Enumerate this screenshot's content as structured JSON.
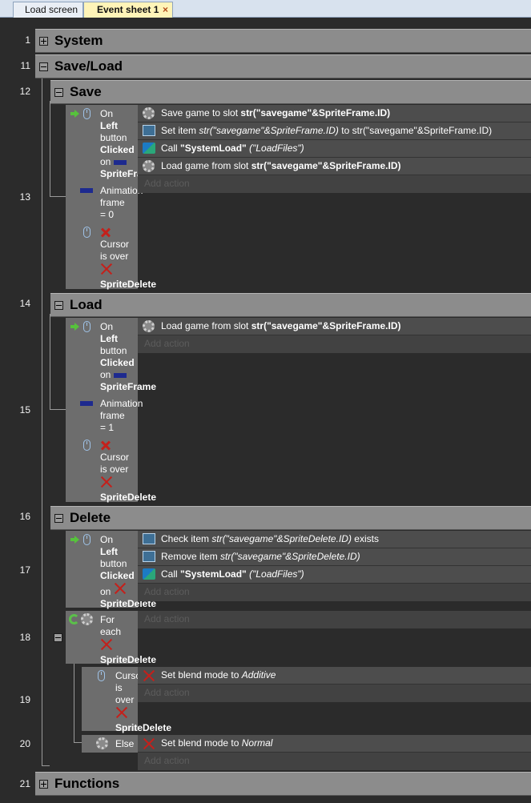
{
  "tabs": [
    "Load screen",
    "Event sheet 1"
  ],
  "tab_close": "×",
  "line_numbers": [
    "1",
    "11",
    "12",
    "13",
    "14",
    "15",
    "16",
    "17",
    "18",
    "19",
    "20",
    "21"
  ],
  "groups": {
    "system": "System",
    "saveload": "Save/Load",
    "save": "Save",
    "load": "Load",
    "delete": "Delete",
    "functions": "Functions"
  },
  "cond": {
    "on": "On",
    "left": "Left",
    "button": "button",
    "clicked": "Clicked",
    "on2": "on",
    "spriteframe": "SpriteFrame",
    "spriteframe_cut": "SpriteFrame",
    "animation": "Animation",
    "frame": "frame",
    "eq0": "= 0",
    "eq1": "= 1",
    "cursor": "Cursor",
    "isover": "is over",
    "is": "is",
    "over": "over",
    "spritedelete": "SpriteDelete",
    "spritedelete_cut": "SpriteDelete",
    "cursor_cut": "Cursc",
    "foreach": "For",
    "each": "each",
    "else": "Else"
  },
  "actions": {
    "save_slot_pre": "Save game to slot ",
    "save_slot_arg": "str(\"savegame\"&SpriteFrame.ID)",
    "setitem_pre": "Set item ",
    "setitem_key": "str(\"savegame\"&SpriteFrame.ID)",
    "setitem_mid": " to ",
    "setitem_val": "str(\"savegame\"&SpriteFrame.ID)",
    "call_pre": "Call ",
    "call_name": "\"SystemLoad\"",
    "call_args": "(\"LoadFiles\")",
    "loadgame_pre": "Load game from slot ",
    "loadgame_arg": "str(\"savegame\"&SpriteFrame.ID)",
    "check_pre": "Check item ",
    "check_arg": "str(\"savegame\"&SpriteDelete.ID)",
    "check_post": " exists",
    "remove_pre": "Remove item ",
    "remove_arg": "str(\"savegame\"&SpriteDelete.ID)",
    "blend_pre": "Set blend mode to ",
    "blend_additive": "Additive",
    "blend_normal": "Normal",
    "add_action": "Add action"
  },
  "colors": {
    "group": "#8c8c8c",
    "condition": "#6d6d6d",
    "action": "#4d4d4d",
    "invert_x": "#c4201b"
  }
}
